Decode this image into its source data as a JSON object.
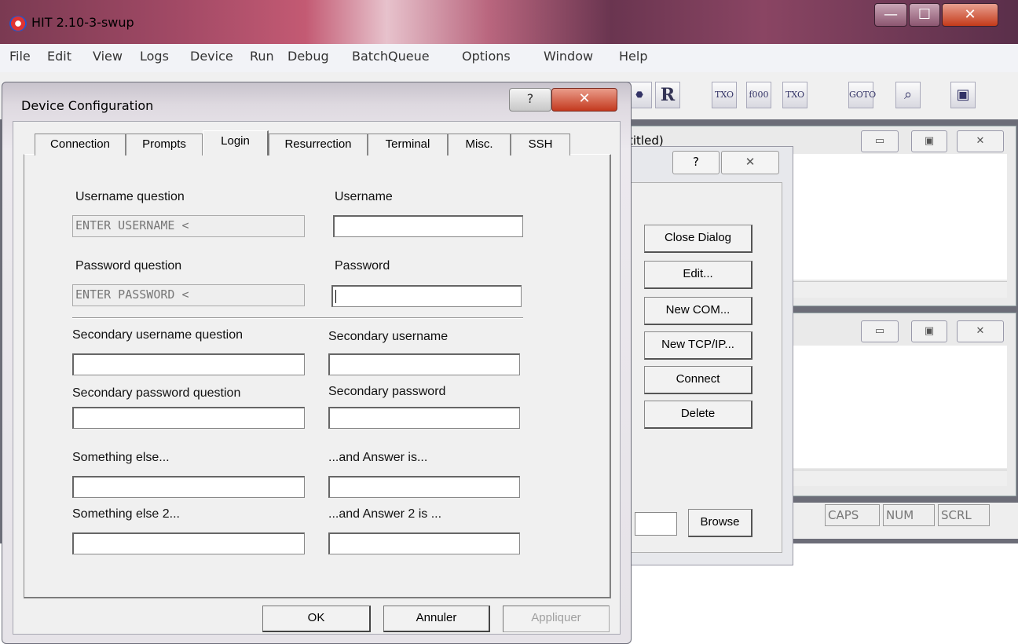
{
  "main_window": {
    "title": "HIT 2.10-3-swup",
    "caption_buttons": {
      "minimize": "—",
      "maximize": "☐",
      "close": "✕"
    },
    "menu": [
      "File",
      "Edit",
      "View",
      "Logs",
      "Device",
      "Run",
      "Debug",
      "BatchQueue",
      "Options",
      "Window",
      "Help"
    ],
    "toolbar_icons": [
      {
        "name": "stop-icon",
        "glyph": "⬣"
      },
      {
        "name": "record-icon",
        "glyph": "R"
      },
      {
        "name": "step-txo-icon",
        "glyph": "TXO"
      },
      {
        "name": "step-f000-icon",
        "glyph": "f000"
      },
      {
        "name": "repeat-txo-icon",
        "glyph": "TXO"
      },
      {
        "name": "goto-icon",
        "glyph": "GOTO"
      },
      {
        "name": "find-icon",
        "glyph": "⌕"
      },
      {
        "name": "device-icon",
        "glyph": "▣"
      }
    ],
    "mdi_child_title_partial": "titled)",
    "status": {
      "caps": "CAPS",
      "num": "NUM",
      "scrl": "SCRL"
    }
  },
  "back_dialog": {
    "help_glyph": "?",
    "close_glyph": "✕",
    "buttons": {
      "close_dialog": "Close Dialog",
      "edit": "Edit...",
      "new_com": "New COM...",
      "new_tcpip": "New TCP/IP...",
      "connect": "Connect",
      "delete": "Delete",
      "browse": "Browse"
    }
  },
  "dialog": {
    "title": "Device Configuration",
    "help_glyph": "?",
    "close_glyph": "✕",
    "tabs": [
      "Connection",
      "Prompts",
      "Login",
      "Resurrection",
      "Terminal",
      "Misc.",
      "SSH"
    ],
    "active_tab": "Login",
    "fields": {
      "username_question_label": "Username question",
      "username_question_value": "ENTER USERNAME <",
      "username_label": "Username",
      "username_value": "",
      "password_question_label": "Password question",
      "password_question_value": "ENTER PASSWORD <",
      "password_label": "Password",
      "password_value": "",
      "secondary_username_question_label": "Secondary username question",
      "secondary_username_label": "Secondary username",
      "secondary_password_question_label": "Secondary password question",
      "secondary_password_label": "Secondary password",
      "something_else_label": "Something else...",
      "answer_label": "...and Answer is...",
      "something_else_2_label": "Something else 2...",
      "answer_2_label": "...and Answer 2 is ..."
    },
    "buttons": {
      "ok": "OK",
      "cancel": "Annuler",
      "apply": "Appliquer"
    }
  }
}
